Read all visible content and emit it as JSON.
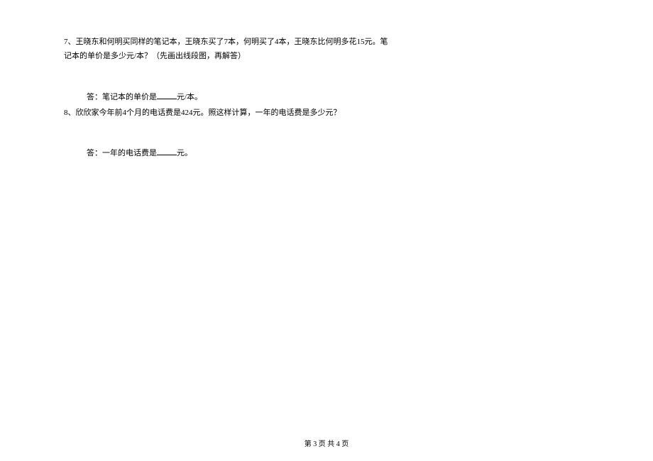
{
  "questions": {
    "q7": {
      "number": "7、",
      "text_line1": "王晓东和何明买同样的笔记本，王晓东买了7本，何明买了4本，王晓东比何明多花15元。笔",
      "text_line2": "记本的单价是多少元/本？（先画出线段图，再解答）",
      "answer_prefix": "答：笔记本的单价是",
      "answer_suffix": "元/本。"
    },
    "q8": {
      "number": "8、",
      "text": "欣欣家今年前4个月的电话费是424元。照这样计算，一年的电话费是多少元？",
      "answer_prefix": "答：一年的电话费是",
      "answer_suffix": "元。"
    }
  },
  "footer": {
    "text": "第 3 页 共 4 页"
  }
}
